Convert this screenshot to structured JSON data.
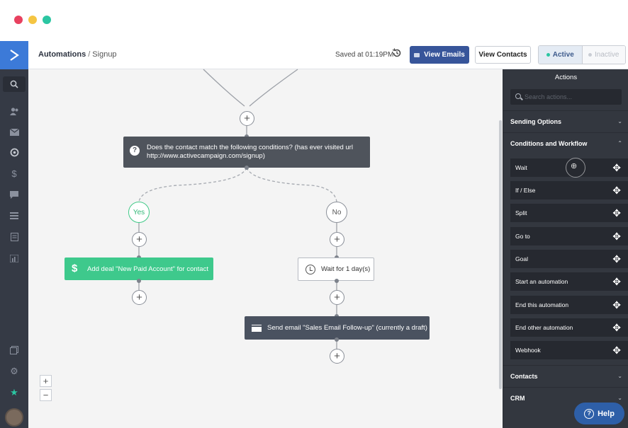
{
  "header": {
    "breadcrumb_root": "Automations",
    "breadcrumb_sep": "/",
    "breadcrumb_current": "Signup",
    "saved_status": "Saved at 01:19PM",
    "view_emails_label": "View Emails",
    "view_contacts_label": "View Contacts",
    "status_active_label": "Active",
    "status_inactive_label": "Inactive"
  },
  "workflow": {
    "condition_text": "Does the contact match the following conditions? (has ever visited url http://www.activecampaign.com/signup)",
    "yes_label": "Yes",
    "no_label": "No",
    "deal_action": "Add deal \"New Paid Account\" for contact",
    "wait_action": "Wait for 1 day(s)",
    "email_action": "Send email \"Sales Email Follow-up\" (currently a draft)",
    "plus": "+",
    "zoom_in": "+",
    "zoom_out": "−"
  },
  "panel": {
    "title": "Actions",
    "search_placeholder": "Search actions...",
    "sections": {
      "sending": "Sending Options",
      "conditions": "Conditions and Workflow",
      "contacts": "Contacts",
      "crm": "CRM"
    },
    "items": [
      "Wait",
      "If / Else",
      "Split",
      "Go to",
      "Goal",
      "Start an automation",
      "End this automation",
      "End other automation",
      "Webhook"
    ]
  },
  "help_label": "Help",
  "colors": {
    "brand_blue": "#3c7ad8",
    "primary_button": "#37559a",
    "yes_green": "#40c987",
    "deal_green": "#3ec98c",
    "panel_bg": "#33373f"
  },
  "icons": {
    "rail": [
      "search-icon",
      "contacts-icon",
      "campaigns-icon",
      "automations-icon",
      "deals-icon",
      "conversations-icon",
      "lists-icon",
      "forms-icon",
      "reports-icon",
      "apps-icon",
      "settings-icon",
      "star-icon"
    ]
  }
}
